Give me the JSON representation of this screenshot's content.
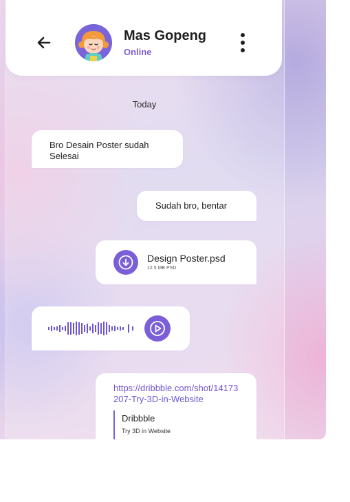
{
  "header": {
    "contact_name": "Mas Gopeng",
    "status": "Online",
    "back_icon": "arrow-left-icon",
    "menu_icon": "more-vertical-icon"
  },
  "conversation": {
    "date_label": "Today",
    "messages": [
      {
        "direction": "incoming",
        "type": "text",
        "text": "Bro Desain Poster sudah Selesai"
      },
      {
        "direction": "outgoing",
        "type": "text",
        "text": "Sudah bro, bentar"
      },
      {
        "direction": "outgoing",
        "type": "file",
        "file_name": "Design Poster.psd",
        "file_meta": "12.5 MB PSD",
        "icon": "download-icon"
      },
      {
        "direction": "incoming",
        "type": "voice",
        "icon": "play-icon"
      },
      {
        "direction": "outgoing",
        "type": "link",
        "url": "https://dribbble.com/shot/14173207-Try-3D-in-Website",
        "preview_title": "Dribbble",
        "preview_desc": "Try 3D in Website"
      }
    ]
  },
  "colors": {
    "accent": "#7a5fd8",
    "status": "#7c5fd6",
    "text": "#222222"
  }
}
